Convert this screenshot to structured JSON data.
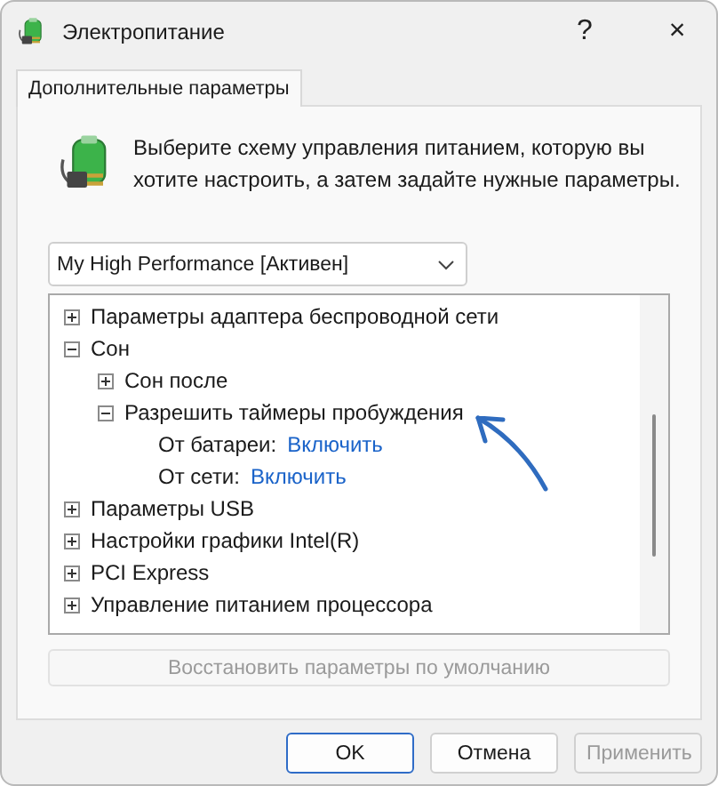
{
  "window": {
    "title": "Электропитание",
    "help": "?",
    "close": "×"
  },
  "tabs": [
    {
      "label": "Дополнительные параметры",
      "selected": true
    }
  ],
  "description": "Выберите схему управления питанием, которую вы хотите настроить, а затем задайте нужные параметры.",
  "plan_select": {
    "value": "My High Performance [Активен]"
  },
  "tree": [
    {
      "kind": "node",
      "label": "Параметры адаптера беспроводной сети",
      "expanded": false
    },
    {
      "kind": "node",
      "label": "Сон",
      "expanded": true,
      "children": [
        {
          "kind": "node",
          "label": "Сон после",
          "expanded": false
        },
        {
          "kind": "node",
          "label": "Разрешить таймеры пробуждения",
          "expanded": true,
          "children": [
            {
              "kind": "setting",
              "label": "От батареи:",
              "value": "Включить"
            },
            {
              "kind": "setting",
              "label": "От сети:",
              "value": "Включить"
            }
          ]
        }
      ]
    },
    {
      "kind": "node",
      "label": "Параметры USB",
      "expanded": false
    },
    {
      "kind": "node",
      "label": "Настройки графики Intel(R)",
      "expanded": false
    },
    {
      "kind": "node",
      "label": "PCI Express",
      "expanded": false
    },
    {
      "kind": "node",
      "label": "Управление питанием процессора",
      "expanded": false
    }
  ],
  "restore_button": {
    "label": "Восстановить параметры по умолчанию",
    "disabled": true
  },
  "buttons": [
    {
      "label": "OK",
      "default": true,
      "disabled": false
    },
    {
      "label": "Отмена",
      "default": false,
      "disabled": false
    },
    {
      "label": "Применить",
      "default": false,
      "disabled": true
    }
  ]
}
